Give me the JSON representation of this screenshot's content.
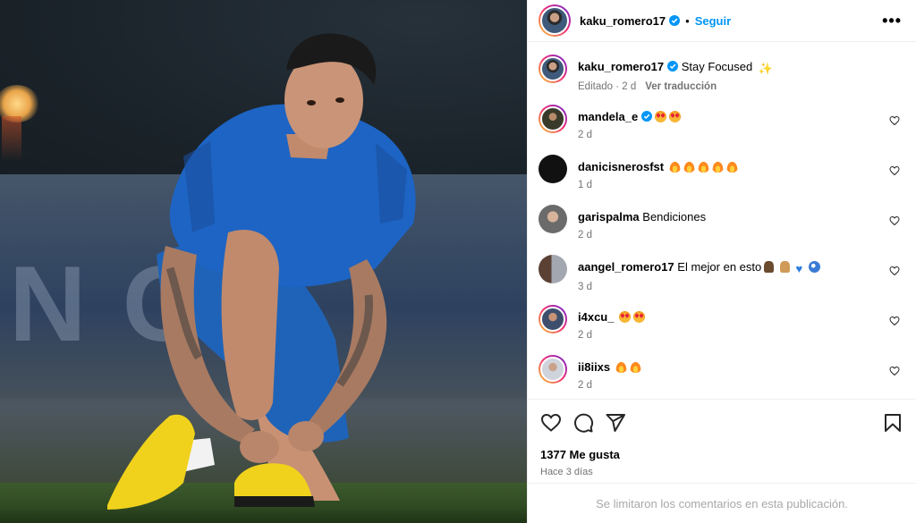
{
  "post": {
    "author": "kaku_romero17",
    "follow_label": "Seguir",
    "separator": "•",
    "caption": "Stay Focused",
    "caption_meta": "Editado · 2 d",
    "translate_label": "Ver traducción",
    "likes": "1377 Me gusta",
    "posted_ago": "Hace 3 días",
    "comments_closed": "Se limitaron los comentarios en esta publicación.",
    "photo_board_text": "NOJ"
  },
  "comments": [
    {
      "user": "mandela_e",
      "verified": true,
      "text": "",
      "emojis": [
        "heart-eyes",
        "heart-eyes"
      ],
      "time": "2 d"
    },
    {
      "user": "danicisnerosfst",
      "verified": false,
      "text": "",
      "emojis": [
        "fire",
        "fire",
        "fire",
        "fire",
        "fire"
      ],
      "time": "1 d"
    },
    {
      "user": "garispalma",
      "verified": false,
      "text": "Bendiciones",
      "emojis": [],
      "time": "2 d"
    },
    {
      "user": "aangel_romero17",
      "verified": false,
      "text": "El mejor en esto",
      "emojis": [
        "pray-dark",
        "pray",
        "blue-heart",
        "soccer-ball"
      ],
      "time": "3 d"
    },
    {
      "user": "i4xcu_",
      "verified": false,
      "text": "",
      "emojis": [
        "heart-eyes",
        "heart-eyes"
      ],
      "time": "2 d"
    },
    {
      "user": "ii8iixs",
      "verified": false,
      "text": "",
      "emojis": [
        "fire",
        "fire"
      ],
      "time": "2 d"
    }
  ],
  "icons": {
    "more": "more-options-icon",
    "like": "heart-icon",
    "comment": "comment-icon",
    "share": "share-icon",
    "save": "bookmark-icon",
    "verified": "verified-badge-icon"
  },
  "colors": {
    "accent": "#0095f6",
    "muted": "#737373",
    "divider": "#efefef",
    "verified": "#0095f6"
  }
}
